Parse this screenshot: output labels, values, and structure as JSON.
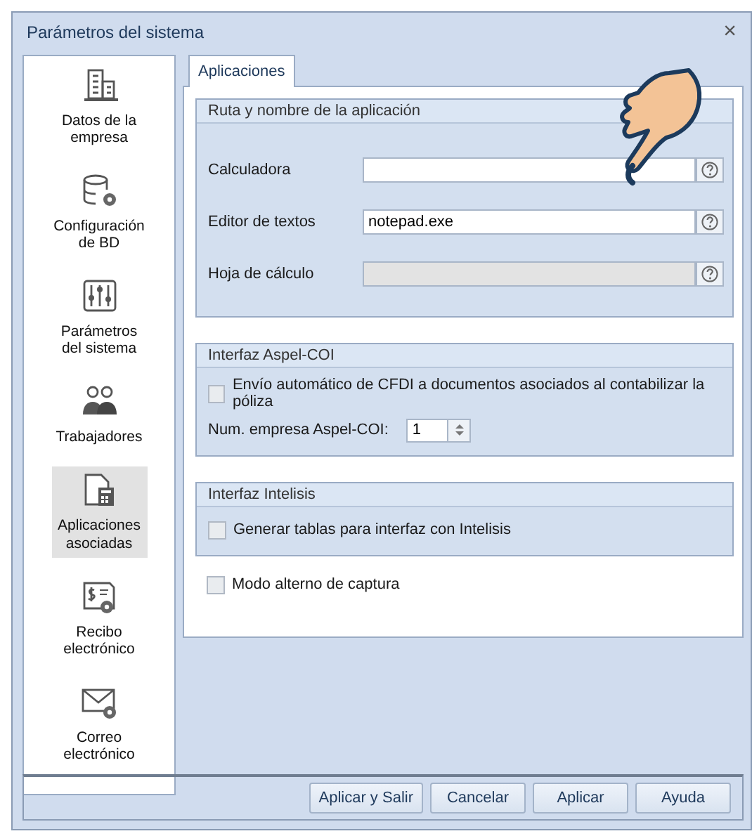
{
  "window": {
    "title": "Parámetros del sistema",
    "close": "×"
  },
  "sidebar": {
    "items": [
      {
        "label": "Datos de la empresa",
        "kind": "building",
        "selected": false
      },
      {
        "label": "Configuración de BD",
        "kind": "database",
        "selected": false
      },
      {
        "label": "Parámetros del sistema",
        "kind": "sliders",
        "selected": false
      },
      {
        "label": "Trabajadores",
        "kind": "people",
        "selected": false
      },
      {
        "label": "Aplicaciones asociadas",
        "kind": "calculator",
        "selected": true
      },
      {
        "label": "Recibo electrónico",
        "kind": "receipt",
        "selected": false
      },
      {
        "label": "Correo electrónico",
        "kind": "mail",
        "selected": false
      }
    ]
  },
  "tabs": [
    {
      "label": "Aplicaciones",
      "selected": true
    }
  ],
  "groups": [
    {
      "title": "Ruta y nombre de la aplicación",
      "rows": [
        {
          "kind": "path",
          "label": "Calculadora",
          "value": "",
          "disabled": false
        },
        {
          "kind": "path",
          "label": "Editor de textos",
          "value": "notepad.exe",
          "disabled": false
        },
        {
          "kind": "path",
          "label": "Hoja de cálculo",
          "value": "",
          "disabled": true
        }
      ]
    },
    {
      "title": "Interfaz Aspel-COI",
      "rows": [
        {
          "kind": "check",
          "label": "Envío automático de CFDI a documentos asociados al contabilizar la póliza",
          "checked": false
        },
        {
          "kind": "spin",
          "label": "Num. empresa Aspel-COI:",
          "value": "1"
        }
      ]
    },
    {
      "title": "Interfaz Intelisis",
      "rows": [
        {
          "kind": "check",
          "label": "Generar tablas para interfaz con Intelisis",
          "checked": false
        }
      ]
    }
  ],
  "options": [
    {
      "label": "Modo alterno de captura",
      "checked": false
    }
  ],
  "buttons": [
    "Aplicar y Salir",
    "Cancelar",
    "Aplicar",
    "Ayuda"
  ]
}
